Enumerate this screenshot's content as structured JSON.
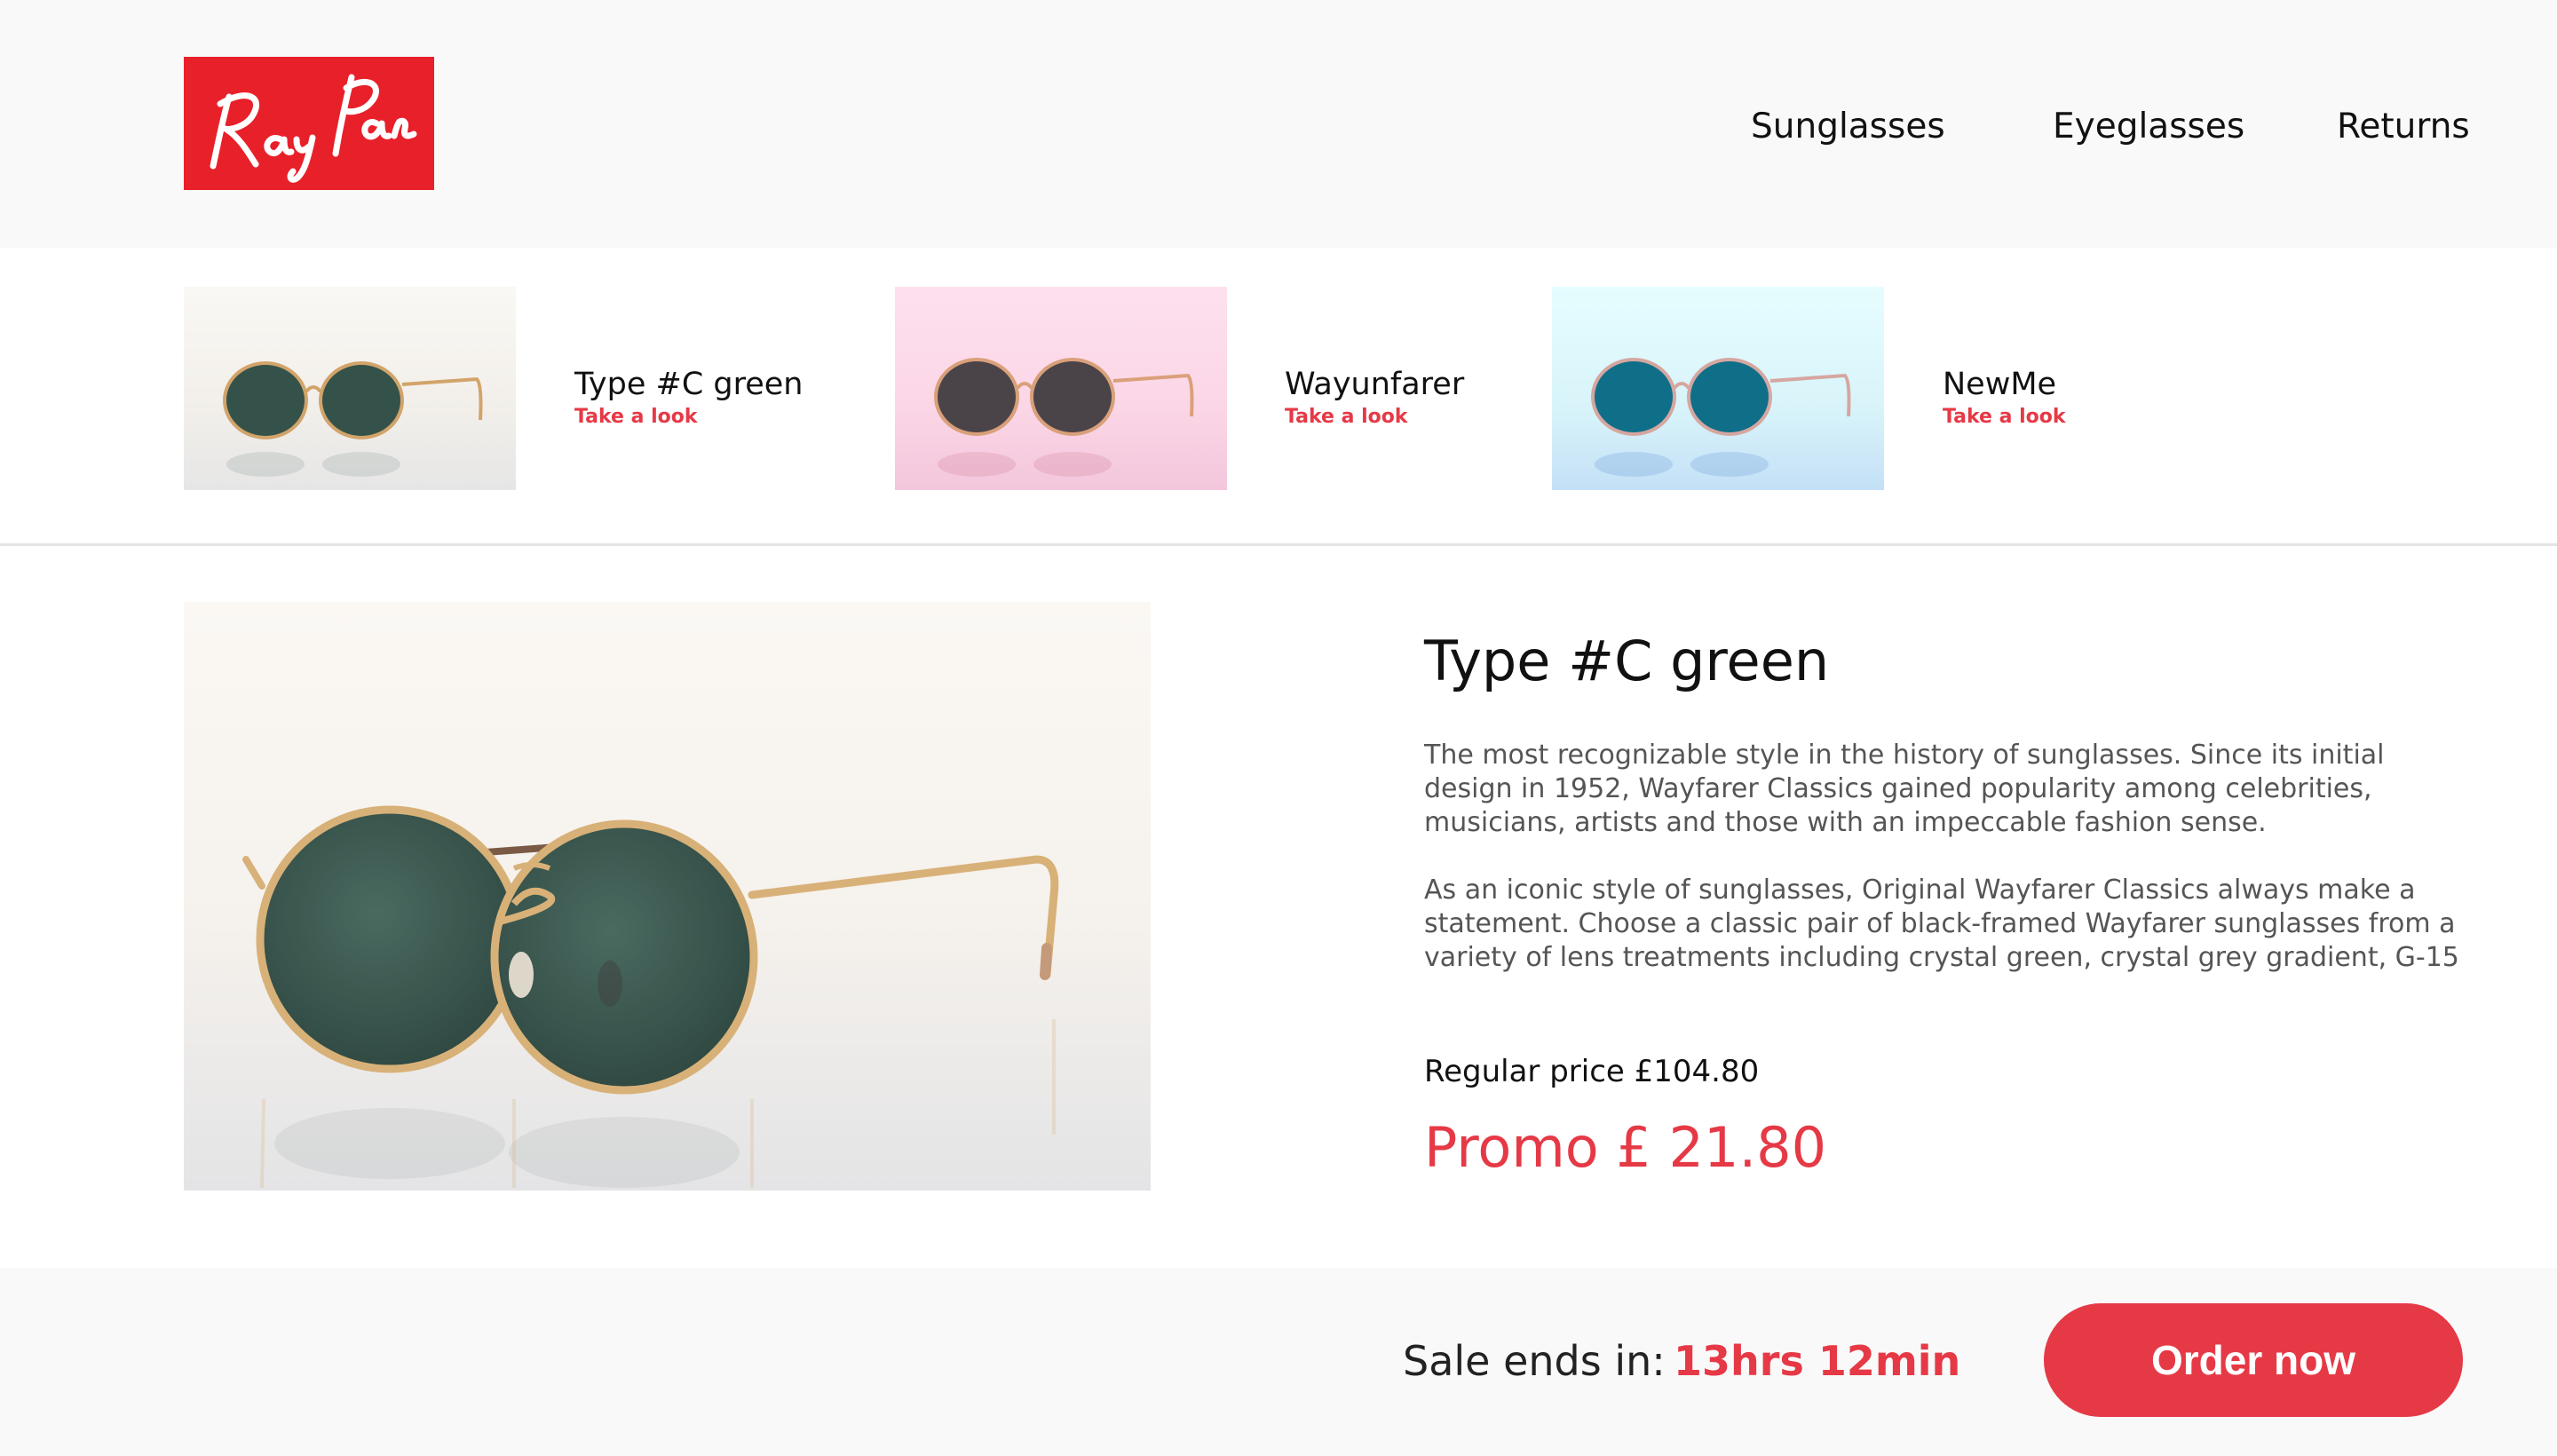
{
  "brand": {
    "logo_text": "Ray Pan",
    "logo_color": "#e8202a"
  },
  "nav": {
    "items": [
      {
        "label": "Sunglasses"
      },
      {
        "label": "Eyeglasses"
      },
      {
        "label": "Returns"
      }
    ]
  },
  "products_strip": [
    {
      "name": "Type #C green",
      "link": "Take a look",
      "lens_color": "#34524a",
      "bg_color": "#f6f4f0"
    },
    {
      "name": "Wayunfarer",
      "link": "Take a look",
      "lens_color": "#4a4448",
      "bg_color": "#fde4f0"
    },
    {
      "name": "NewMe",
      "link": "Take a look",
      "lens_color": "#0f6f88",
      "bg_color": "#e4fbfd"
    }
  ],
  "product": {
    "title": "Type #C green",
    "description_1": "The most recognizable style in the history of sunglasses. Since its initial design in 1952, Wayfarer Classics gained popularity among celebrities, musicians, artists and those with an impeccable fashion sense.",
    "description_2": "As an iconic style of sunglasses, Original Wayfarer Classics always make a statement. Choose a classic pair of black-framed Wayfarer sunglasses from a variety of lens treatments including crystal green, crystal grey gradient, G-15",
    "regular_price": "Regular price £104.80",
    "promo_price": "Promo £ 21.80"
  },
  "footer": {
    "sale_label": "Sale ends in:",
    "sale_time": "13hrs 12min",
    "order_button": "Order now"
  },
  "colors": {
    "accent": "#e63946",
    "header_bg": "#f9f9f9"
  }
}
